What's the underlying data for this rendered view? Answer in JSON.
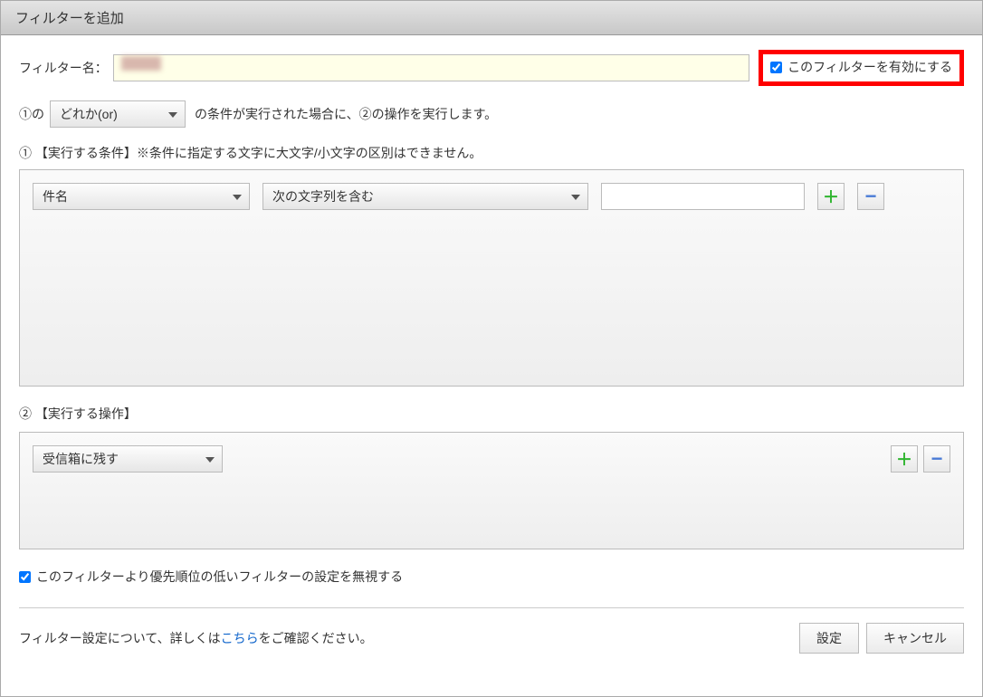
{
  "dialog": {
    "title": "フィルターを追加"
  },
  "filterName": {
    "label": "フィルター名：",
    "value": ""
  },
  "enableFilter": {
    "label": "このフィルターを有効にする",
    "checked": true
  },
  "logic": {
    "prefix": "①の",
    "dropdown": "どれか(or)",
    "suffix": "の条件が実行された場合に、②の操作を実行します。"
  },
  "conditionsHeader": "① 【実行する条件】※条件に指定する文字に大文字/小文字の区別はできません。",
  "conditions": {
    "field": "件名",
    "operator": "次の文字列を含む",
    "value": ""
  },
  "actionsHeader": "② 【実行する操作】",
  "actions": {
    "select": "受信箱に残す"
  },
  "priority": {
    "label": "このフィルターより優先順位の低いフィルターの設定を無視する",
    "checked": true
  },
  "footer": {
    "textBefore": "フィルター設定について、詳しくは",
    "link": "こちら",
    "textAfter": "をご確認ください。",
    "submit": "設定",
    "cancel": "キャンセル"
  }
}
